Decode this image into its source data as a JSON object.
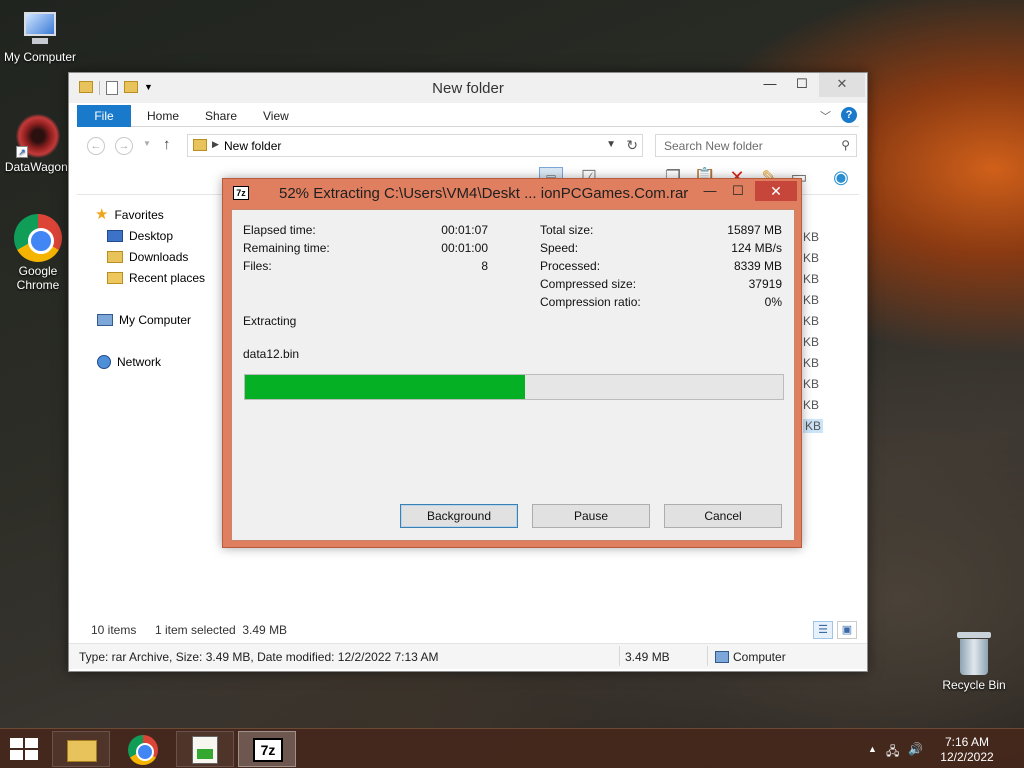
{
  "desktop": {
    "icons": [
      {
        "label": "My Computer"
      },
      {
        "label": "DataWagon."
      },
      {
        "label": "Google Chrome"
      },
      {
        "label": "Recycle Bin"
      }
    ]
  },
  "explorer": {
    "title": "New folder",
    "ribbon_tabs": [
      "File",
      "Home",
      "Share",
      "View"
    ],
    "address": "New folder",
    "search_placeholder": "Search New folder",
    "nav": {
      "favorites": "Favorites",
      "desktop": "Desktop",
      "downloads": "Downloads",
      "recent": "Recent places",
      "computer": "My Computer",
      "network": "Network"
    },
    "size_unit": "KB",
    "status": {
      "items": "10 items",
      "selected": "1 item selected  3.49 MB"
    },
    "details": {
      "info": "Type: rar Archive, Size: 3.49 MB, Date modified: 12/2/2022 7:13 AM",
      "size": "3.49 MB",
      "location": "Computer"
    }
  },
  "zip_dialog": {
    "logo": "7z",
    "title": "52% Extracting C:\\Users\\VM4\\Deskt ... ionPCGames.Com.rar",
    "progress_fraction": 0.52,
    "left_stats": [
      {
        "label": "Elapsed time:",
        "value": "00:01:07"
      },
      {
        "label": "Remaining time:",
        "value": "00:01:00"
      },
      {
        "label": "Files:",
        "value": "8"
      }
    ],
    "right_stats": [
      {
        "label": "Total size:",
        "value": "15897 MB"
      },
      {
        "label": "Speed:",
        "value": "124 MB/s"
      },
      {
        "label": "Processed:",
        "value": "8339 MB"
      },
      {
        "label": "Compressed size:",
        "value": "37919"
      },
      {
        "label": "Compression ratio:",
        "value": "0%"
      }
    ],
    "operation": "Extracting",
    "current_file": "data12.bin",
    "buttons": {
      "background": "Background",
      "pause": "Pause",
      "cancel": "Cancel"
    }
  },
  "taskbar": {
    "app_7z_label": "7z",
    "time": "7:16 AM",
    "date": "12/2/2022"
  },
  "colors": {
    "progress_fill": "#06b025",
    "dialog_frame": "#e07f60",
    "file_tab": "#1979ca"
  }
}
